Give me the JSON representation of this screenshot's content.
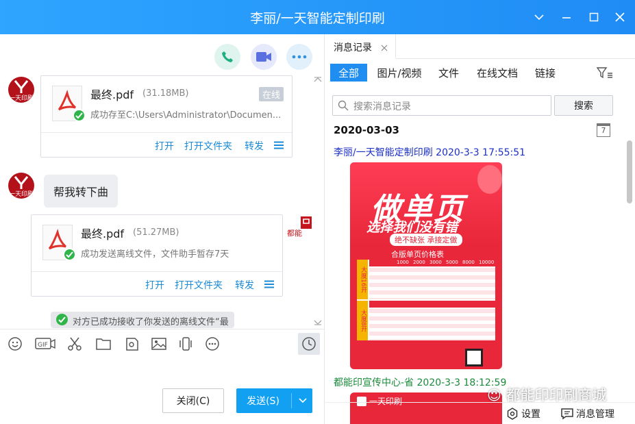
{
  "window": {
    "title": "李丽/一天智能定制印刷"
  },
  "left": {
    "message1": {
      "file_name": "最终.pdf",
      "file_size": "(31.18MB)",
      "status": "成功存至C:\\Users\\Administrator\\Documen...",
      "tag": "在线",
      "actions": [
        "打开",
        "打开文件夹",
        "转发"
      ]
    },
    "message2": {
      "text": "帮我转下曲"
    },
    "message3": {
      "file_name": "最终.pdf",
      "file_size": "(51.27MB)",
      "status": "成功发送离线文件，文件助手暂存7天",
      "actions": [
        "打开",
        "打开文件夹",
        "转发"
      ]
    },
    "message4": {
      "text": "对方已成功接收了你发送的离线文件“最"
    },
    "avatar_text": "一天印刷",
    "avatar_right_text": "都能",
    "buttons": {
      "close": "关闭(C)",
      "send": "发送(S)"
    }
  },
  "right": {
    "tab_title": "消息记录",
    "filters": [
      "全部",
      "图片/视频",
      "文件",
      "在线文档",
      "链接"
    ],
    "search_placeholder": "搜索消息记录",
    "search_button": "搜索",
    "date": "2020-03-03",
    "calendar_day": "7",
    "entries": [
      {
        "sender": "李丽/一天智能定制印刷 2020-3-3 17:55:51",
        "color": "#1a2fc4"
      },
      {
        "sender": "都能印宣传中心-省 2020-3-3 18:12:59",
        "color": "#1a8a3a"
      }
    ],
    "poster": {
      "headline": "做单页",
      "sub": "选择我们没有错",
      "badge": "绝不缺张 承接定做",
      "table_title": "合版单页价格表",
      "side1": "大度16开",
      "side2": "大度8开",
      "cols": [
        "1000",
        "2000",
        "3000",
        "5000",
        "8000",
        "10000"
      ]
    },
    "poster2_text": "一天印刷",
    "watermark": "都能印印刷商城",
    "settings": "设置",
    "message_manager": "消息管理"
  },
  "colors": {
    "titlebar": "#1f8cf5",
    "accent": "#1f8ef0",
    "send": "#12a1f2",
    "link": "#1a8ad6",
    "poster": "#e8273a"
  },
  "icons": [
    "phone-icon",
    "video-icon",
    "more-icon",
    "emoji-icon",
    "gif-icon",
    "scissors-icon",
    "folder-icon",
    "image-icon",
    "shake-icon",
    "clock-icon",
    "filter-icon",
    "calendar-icon",
    "gear-icon"
  ]
}
